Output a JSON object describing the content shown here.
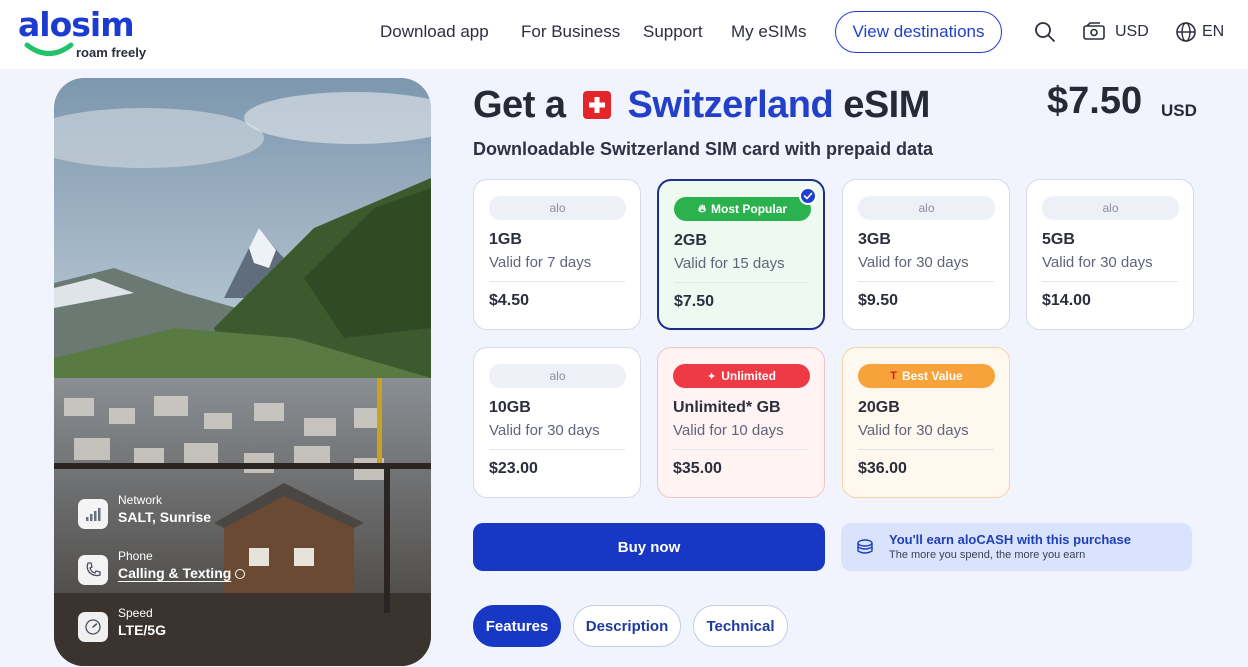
{
  "header": {
    "logo_word": "alosim",
    "logo_tagline": "roam freely",
    "nav": [
      "Download app",
      "For Business",
      "Support",
      "My eSIMs"
    ],
    "cta": "View destinations",
    "currency": "USD",
    "language": "EN",
    "icons": [
      "search-icon",
      "currency-icon",
      "globe-icon"
    ]
  },
  "hero": {
    "specs": [
      {
        "label": "Network",
        "value": "SALT, Sunrise",
        "icon": "signal-icon"
      },
      {
        "label": "Phone",
        "value": "Calling & Texting",
        "icon": "phone-icon"
      },
      {
        "label": "Speed",
        "value": "LTE/5G",
        "icon": "speed-icon"
      }
    ]
  },
  "product": {
    "title_prefix": "Get a",
    "country": "Switzerland",
    "title_suffix": "eSIM",
    "price": "$7.50",
    "price_currency": "USD",
    "subtitle": "Downloadable Switzerland SIM card with prepaid data"
  },
  "plans": [
    {
      "badge": "alo",
      "data": "1GB",
      "validity": "Valid for 7 days",
      "price": "$4.50"
    },
    {
      "badge": "Most Popular",
      "data": "2GB",
      "validity": "Valid for 15 days",
      "price": "$7.50",
      "selected": true
    },
    {
      "badge": "alo",
      "data": "3GB",
      "validity": "Valid for 30 days",
      "price": "$9.50"
    },
    {
      "badge": "alo",
      "data": "5GB",
      "validity": "Valid for 30 days",
      "price": "$14.00"
    },
    {
      "badge": "alo",
      "data": "10GB",
      "validity": "Valid for 30 days",
      "price": "$23.00"
    },
    {
      "badge": "Unlimited",
      "data": "Unlimited* GB",
      "validity": "Valid for 10 days",
      "price": "$35.00"
    },
    {
      "badge": "Best Value",
      "data": "20GB",
      "validity": "Valid for 30 days",
      "price": "$36.00"
    }
  ],
  "actions": {
    "buy": "Buy now",
    "cash_title": "You'll earn aloCASH with this purchase",
    "cash_subtitle": "The more you spend, the more you earn"
  },
  "tabs": [
    "Features",
    "Description",
    "Technical"
  ],
  "colors": {
    "brand": "#1b3bd1",
    "primary_button": "#1737c4",
    "popular_badge": "#2bb24f",
    "unlimited_badge": "#ee3a45",
    "best_value_badge": "#f7a23a",
    "page_bg": "#f1f4fc"
  }
}
